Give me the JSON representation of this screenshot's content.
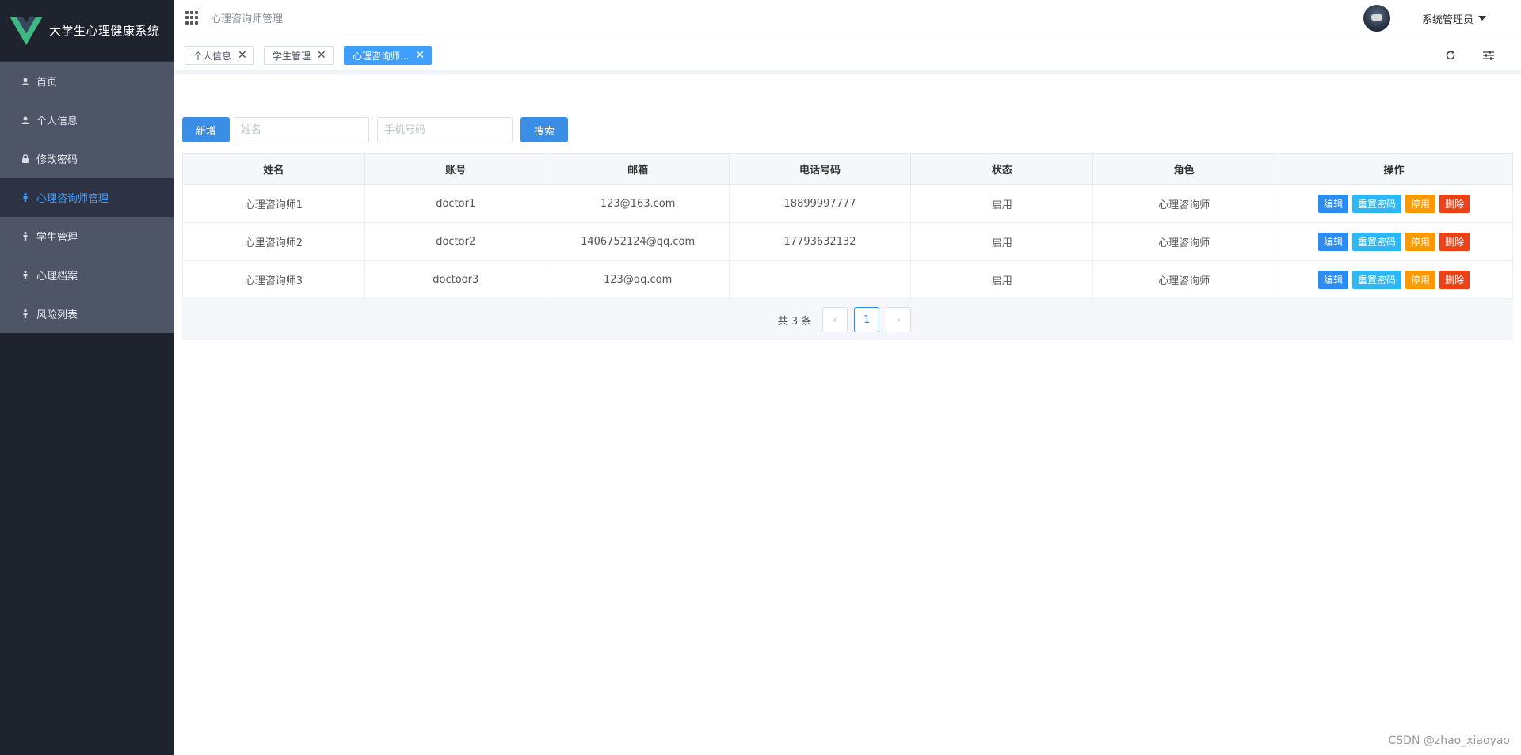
{
  "app": {
    "title": "大学生心理健康系统"
  },
  "sidebar": {
    "items": [
      {
        "label": "首页",
        "icon": "user-icon"
      },
      {
        "label": "个人信息",
        "icon": "user-icon"
      },
      {
        "label": "修改密码",
        "icon": "lock-icon"
      },
      {
        "label": "心理咨询师管理",
        "icon": "person-icon",
        "active": true
      },
      {
        "label": "学生管理",
        "icon": "person-icon"
      },
      {
        "label": "心理档案",
        "icon": "person-icon"
      },
      {
        "label": "风险列表",
        "icon": "person-icon"
      }
    ]
  },
  "header": {
    "breadcrumb": "心理咨询师管理",
    "user_name": "系统管理员"
  },
  "tags": [
    {
      "label": "个人信息",
      "active": false
    },
    {
      "label": "学生管理",
      "active": false
    },
    {
      "label": "心理咨询师...",
      "active": true
    }
  ],
  "toolbar": {
    "add_label": "新增",
    "name_placeholder": "姓名",
    "phone_placeholder": "手机号码",
    "search_label": "搜索"
  },
  "table": {
    "columns": [
      "姓名",
      "账号",
      "邮箱",
      "电话号码",
      "状态",
      "角色",
      "操作"
    ],
    "rows": [
      {
        "name": "心理咨询师1",
        "account": "doctor1",
        "email": "123@163.com",
        "phone": "18899997777",
        "status": "启用",
        "role": "心理咨询师"
      },
      {
        "name": "心里咨询师2",
        "account": "doctor2",
        "email": "1406752124@qq.com",
        "phone": "17793632132",
        "status": "启用",
        "role": "心理咨询师"
      },
      {
        "name": "心理咨询师3",
        "account": "doctoor3",
        "email": "123@qq.com",
        "phone": "",
        "status": "启用",
        "role": "心理咨询师"
      }
    ],
    "actions": {
      "edit": "编辑",
      "reset": "重置密码",
      "disable": "停用",
      "delete": "删除"
    }
  },
  "pagination": {
    "total_text": "共 3 条",
    "current_page": "1",
    "prev": "‹",
    "next": "›"
  },
  "watermark": "CSDN @zhao_xiaoyao",
  "colors": {
    "primary": "#409eff",
    "sidebar_bg": "#1f232e",
    "menu_bg": "#4e5567",
    "success": "#19be6b",
    "warning": "#ff9900",
    "danger": "#ed4014",
    "info": "#2db7f5"
  }
}
